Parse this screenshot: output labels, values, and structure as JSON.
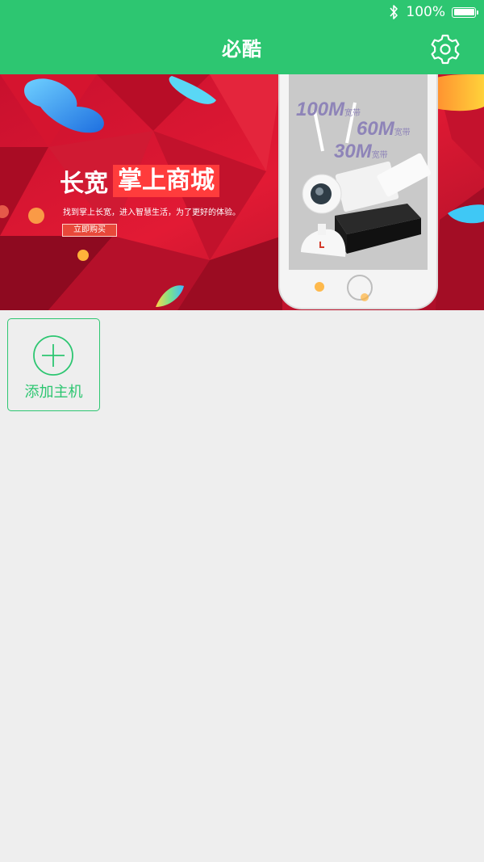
{
  "colors": {
    "brand": "#2dc671",
    "background": "#eeeeee"
  },
  "status_bar": {
    "battery": "100%",
    "icons": [
      "bluetooth-icon",
      "battery-icon"
    ]
  },
  "nav": {
    "title": "必酷",
    "settings_icon": "gear-icon"
  },
  "banner": {
    "headline_left": "长宽",
    "headline_highlight": "掌上商城",
    "subtitle": "找到掌上长宽，进入智慧生活，为了更好的体验。",
    "cta": "立即购买",
    "phone_lines": [
      {
        "speed": "100M",
        "unit": "宽带"
      },
      {
        "speed": "60M",
        "unit": "宽带"
      },
      {
        "speed": "30M",
        "unit": "宽带"
      }
    ]
  },
  "add_host": {
    "label": "添加主机",
    "icon": "plus-circle-icon"
  }
}
